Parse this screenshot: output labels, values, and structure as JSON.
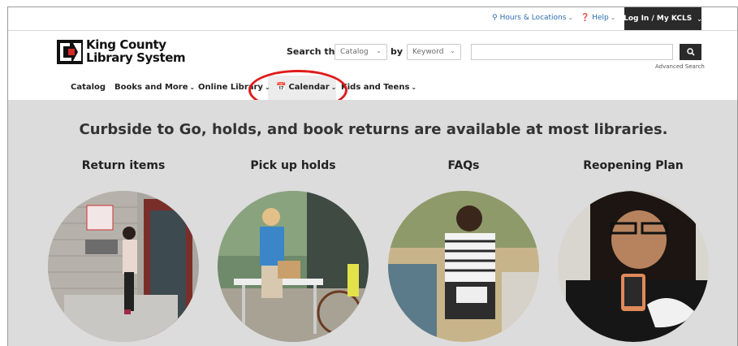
{
  "utility_bar": {
    "hours": "Hours & Locations",
    "help": "Help",
    "login": "Log In / My KCLS"
  },
  "logo": {
    "line1": "King County",
    "line2": "Library System"
  },
  "search": {
    "label": "Search the",
    "scope_selected": "Catalog",
    "by_label": "by",
    "field_selected": "Keyword",
    "query": "",
    "advanced": "Advanced Search"
  },
  "nav": {
    "items": [
      {
        "label": "Catalog"
      },
      {
        "label": "Books and More"
      },
      {
        "label": "Online Library"
      },
      {
        "label": "Calendar"
      },
      {
        "label": "Kids and Teens"
      }
    ]
  },
  "hero": {
    "headline": "Curbside to Go, holds, and book returns are available at most libraries.",
    "cards": [
      {
        "label": "Return items"
      },
      {
        "label": "Pick up holds"
      },
      {
        "label": "FAQs"
      },
      {
        "label": "Reopening Plan"
      }
    ]
  },
  "colors": {
    "accent_link": "#2b6cb0",
    "dark_button": "#2a2a2a",
    "hero_bg": "#dcdcdc",
    "annotation": "#e01b1b"
  },
  "icons": [
    "map-marker-icon",
    "question-circle-icon",
    "chevron-down-icon",
    "search-icon",
    "calendar-icon"
  ]
}
